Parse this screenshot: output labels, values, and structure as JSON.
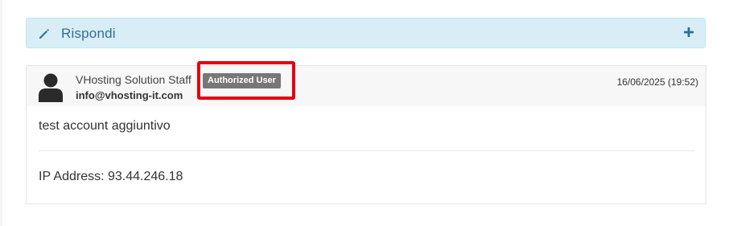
{
  "reply": {
    "label": "Rispondi",
    "icon": "pencil-icon",
    "toggle_icon": "plus-icon",
    "accent_color": "#31708f",
    "background_color": "#d9edf7"
  },
  "message": {
    "sender_name": "VHosting Solution Staff",
    "sender_email": "info@vhosting-it.com",
    "badge": "Authorized User",
    "date": "16/06/2025 (19:52)",
    "body": "test account aggiuntivo",
    "ip_line": "IP Address: 93.44.246.18",
    "avatar_icon": "user-avatar-icon",
    "highlight_color": "#e3000f"
  }
}
